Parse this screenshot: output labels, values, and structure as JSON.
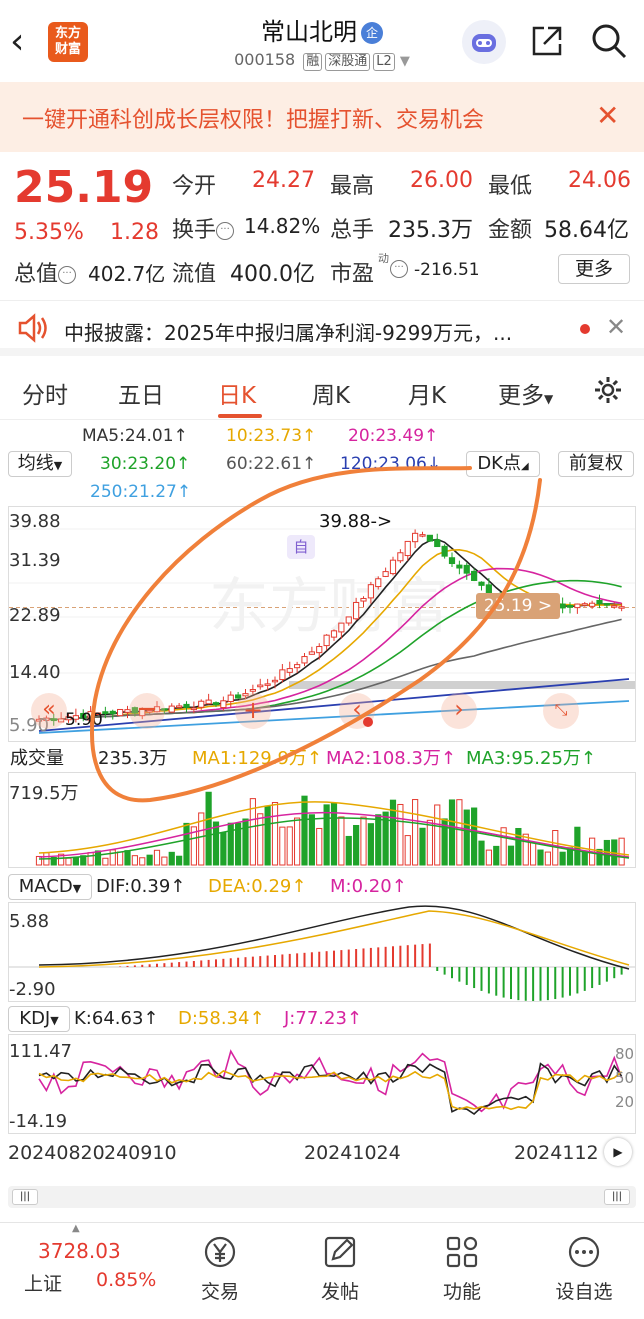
{
  "header": {
    "title": "常山北明",
    "qi_badge": "企",
    "code": "000158",
    "tags": [
      "融",
      "深股通",
      "L2"
    ],
    "logo_text": "东方\n财富"
  },
  "banner": {
    "text": "一键开通科创成长层权限！把握打新、交易机会",
    "close": "✕"
  },
  "quote": {
    "price": "25.19",
    "change_pct": "5.35%",
    "change": "1.28",
    "open_label": "今开",
    "open": "24.27",
    "high_label": "最高",
    "high": "26.00",
    "low_label": "最低",
    "low": "24.06",
    "turnover_label": "换手",
    "turnover": "14.82%",
    "volume_label": "总手",
    "volume": "235.3万",
    "amount_label": "金额",
    "amount": "58.64亿",
    "mktcap_label": "总值",
    "mktcap": "402.7亿",
    "float_label": "流值",
    "float": "400.0亿",
    "pe_label": "市盈",
    "pe_sup": "动",
    "pe": "-216.51",
    "more_label": "更多"
  },
  "news": {
    "text": "中报披露：2025年中报归属净利润-9299万元，..."
  },
  "tabs": {
    "items": [
      "分时",
      "五日",
      "日K",
      "周K",
      "月K",
      "更多"
    ],
    "active": "日K"
  },
  "ma_panel": {
    "selector": "均线",
    "ma5": "MA5:24.01↑",
    "ma10": "10:23.73↑",
    "ma20": "20:23.49↑",
    "ma30": "30:23.20↑",
    "ma60": "60:22.61↑",
    "ma120": "120:23.06↓",
    "ma250": "250:21.27↑",
    "dk": "DK点",
    "adjust": "前复权"
  },
  "kline": {
    "y_labels": [
      "39.88",
      "31.39",
      "22.89",
      "14.40",
      "5.90"
    ],
    "high_marker": "39.88->",
    "low_marker": "5.90",
    "price_tag": "25.19 >",
    "self_marker": "自",
    "watermark": "东方财富"
  },
  "volume": {
    "label": "成交量",
    "value": "235.3万",
    "ma1": "MA1:129.9万↑",
    "ma2": "MA2:108.3万↑",
    "ma3": "MA3:95.25万↑",
    "ymax": "719.5万"
  },
  "macd": {
    "label": "MACD",
    "dif": "DIF:0.39↑",
    "dea": "DEA:0.29↑",
    "m": "M:0.20↑",
    "ymax": "5.88",
    "ymin": "-2.90"
  },
  "kdj": {
    "label": "KDJ",
    "k": "K:64.63↑",
    "d": "D:58.34↑",
    "j": "J:77.23↑",
    "ymax": "111.47",
    "ymin": "-14.19",
    "levels": [
      "80",
      "50",
      "20"
    ]
  },
  "dates": [
    "20240820",
    "240910",
    "20241024",
    "2024112"
  ],
  "bottom": {
    "index_value": "3728.03",
    "index_name": "上证",
    "index_pct": "0.85%",
    "items": [
      "交易",
      "发帖",
      "功能",
      "设自选"
    ]
  },
  "colors": {
    "up": "#e43a2f",
    "down": "#1fa32a",
    "accent": "#e5522f"
  }
}
